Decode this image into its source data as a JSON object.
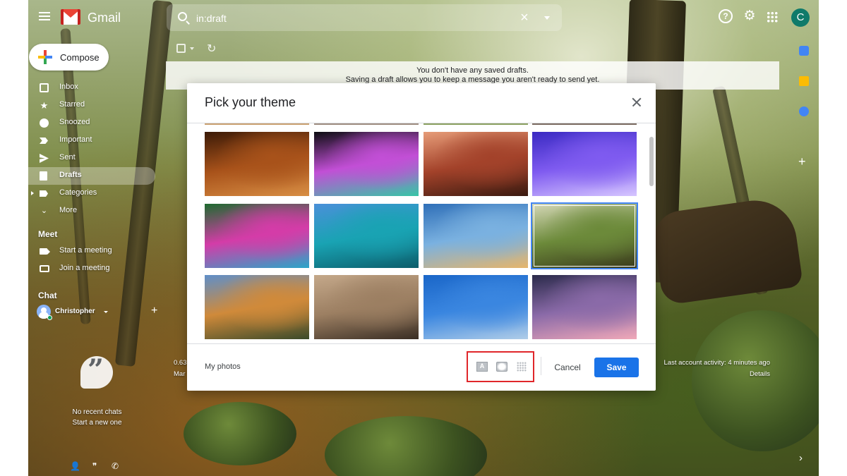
{
  "app": {
    "name": "Gmail"
  },
  "search": {
    "value": "in:draft"
  },
  "sidebar": {
    "compose_label": "Compose",
    "items": [
      {
        "label": "Inbox",
        "icon": "inbox-icon"
      },
      {
        "label": "Starred",
        "icon": "star-icon"
      },
      {
        "label": "Snoozed",
        "icon": "clock-icon"
      },
      {
        "label": "Important",
        "icon": "important-icon"
      },
      {
        "label": "Sent",
        "icon": "send-icon"
      },
      {
        "label": "Drafts",
        "icon": "draft-icon",
        "active": true
      },
      {
        "label": "Categories",
        "icon": "label-icon"
      },
      {
        "label": "More",
        "icon": "chevron-down-icon"
      }
    ],
    "meet": {
      "title": "Meet",
      "start": "Start a meeting",
      "join": "Join a meeting"
    },
    "chat": {
      "title": "Chat",
      "user": "Christopher",
      "empty_line1": "No recent chats",
      "empty_line2": "Start a new one"
    }
  },
  "user": {
    "initial": "C"
  },
  "banner": {
    "line1": "You don't have any saved drafts.",
    "line2": "Saving a draft allows you to keep a message you aren't ready to send yet."
  },
  "background": {
    "activity_line1": "Last account activity: 4 minutes ago",
    "activity_line2": "Details",
    "storage_line1": "0.63",
    "storage_line2": "Mar"
  },
  "dialog": {
    "title": "Pick your theme",
    "my_photos": "My photos",
    "cancel": "Cancel",
    "save": "Save",
    "text_background_glyph": "A",
    "themes": [
      {
        "name": "autumn-leaves",
        "colors": [
          "#3b1a07",
          "#a8521a",
          "#d88e44"
        ]
      },
      {
        "name": "bokeh-lights",
        "colors": [
          "#0d0d12",
          "#c24fd6",
          "#36c6a6"
        ]
      },
      {
        "name": "canyon",
        "colors": [
          "#e69c78",
          "#a3422a",
          "#3a1a10"
        ]
      },
      {
        "name": "jellyfish",
        "colors": [
          "#3a2ac2",
          "#7f5bf0",
          "#d6c6ff"
        ]
      },
      {
        "name": "water-droplet",
        "colors": [
          "#1e6b2f",
          "#d43ca8",
          "#2aa6c8"
        ]
      },
      {
        "name": "lake-tahoe",
        "colors": [
          "#4a90d9",
          "#19a3b3",
          "#0c5d6b"
        ]
      },
      {
        "name": "beach",
        "colors": [
          "#2f6fb8",
          "#7ab1e0",
          "#e6b56a"
        ]
      },
      {
        "name": "forest",
        "colors": [
          "#d6d8b8",
          "#6c8a3a",
          "#3a3a1c"
        ],
        "selected": true
      },
      {
        "name": "golden-gate",
        "colors": [
          "#5f8fc9",
          "#d08a3a",
          "#3a4a2a"
        ]
      },
      {
        "name": "desert-rock",
        "colors": [
          "#c4a88a",
          "#9c7f62",
          "#3a2e24"
        ]
      },
      {
        "name": "city-buildings",
        "colors": [
          "#1a66c8",
          "#3a86e0",
          "#b0cde8"
        ]
      },
      {
        "name": "stormy-sky",
        "colors": [
          "#2a2a4a",
          "#8a6aa8",
          "#f0a8b8"
        ]
      }
    ]
  }
}
